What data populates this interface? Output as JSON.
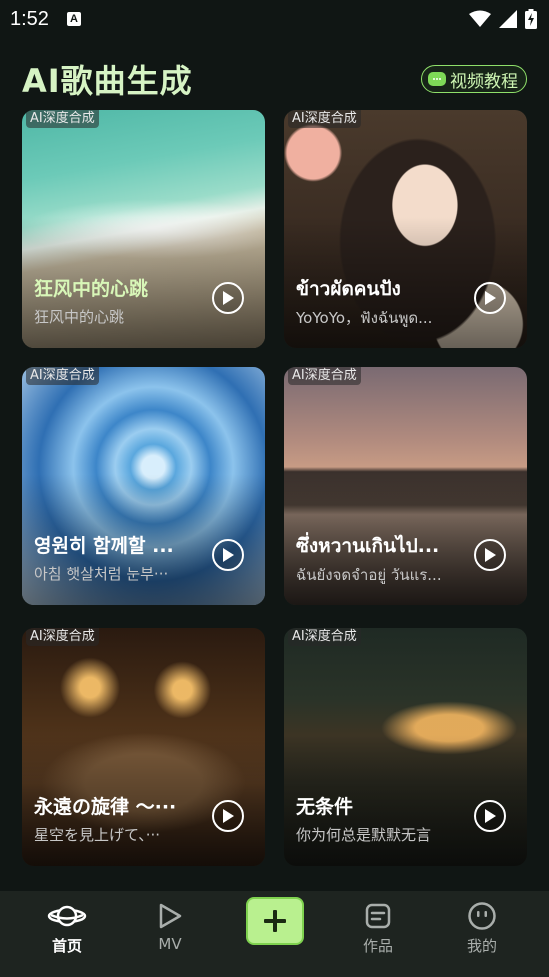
{
  "status_bar": {
    "time": "1:52",
    "icons": [
      "notification-a-icon",
      "wifi-icon",
      "signal-icon",
      "battery-charging-icon"
    ]
  },
  "header": {
    "title": "AI歌曲生成",
    "tutorial_label": "视频教程",
    "tutorial_icon": "video-chat-icon"
  },
  "cards": [
    {
      "badge": "AI深度合成",
      "title": "狂风中的心跳",
      "subtitle": "狂风中的心跳",
      "title_color": "#d8f7b8"
    },
    {
      "badge": "AI深度合成",
      "title": "ข้าวผัดคนปัง",
      "subtitle": "YoYoYo，ฟังฉันพูด...",
      "title_color": "#ffffff"
    },
    {
      "badge": "AI深度合成",
      "title": "영원히 함께할 ...",
      "subtitle": "아침 햇살처럼 눈부···",
      "title_color": "#ffffff"
    },
    {
      "badge": "AI深度合成",
      "title": "ซึ่งหวานเกินไป...",
      "subtitle": "ฉันยังจดจำอยู่ วันแร...",
      "title_color": "#ffffff"
    },
    {
      "badge": "AI深度合成",
      "title": "永遠の旋律 〜···",
      "subtitle": "星空を見上げて、···",
      "title_color": "#ffffff"
    },
    {
      "badge": "AI深度合成",
      "title": "无条件",
      "subtitle": "你为何总是默默无言",
      "title_color": "#ffffff"
    }
  ],
  "nav": {
    "items": [
      {
        "label": "首页",
        "icon": "planet-icon",
        "active": true
      },
      {
        "label": "MV",
        "icon": "play-triangle-icon",
        "active": false
      },
      {
        "label": "",
        "icon": "plus-icon",
        "active": false
      },
      {
        "label": "作品",
        "icon": "document-icon",
        "active": false
      },
      {
        "label": "我的",
        "icon": "smiley-icon",
        "active": false
      }
    ]
  },
  "colors": {
    "background": "#101614",
    "accent_green": "#8fe06a",
    "title_green": "#d6f3c4",
    "nav_bg": "#1e2420"
  }
}
